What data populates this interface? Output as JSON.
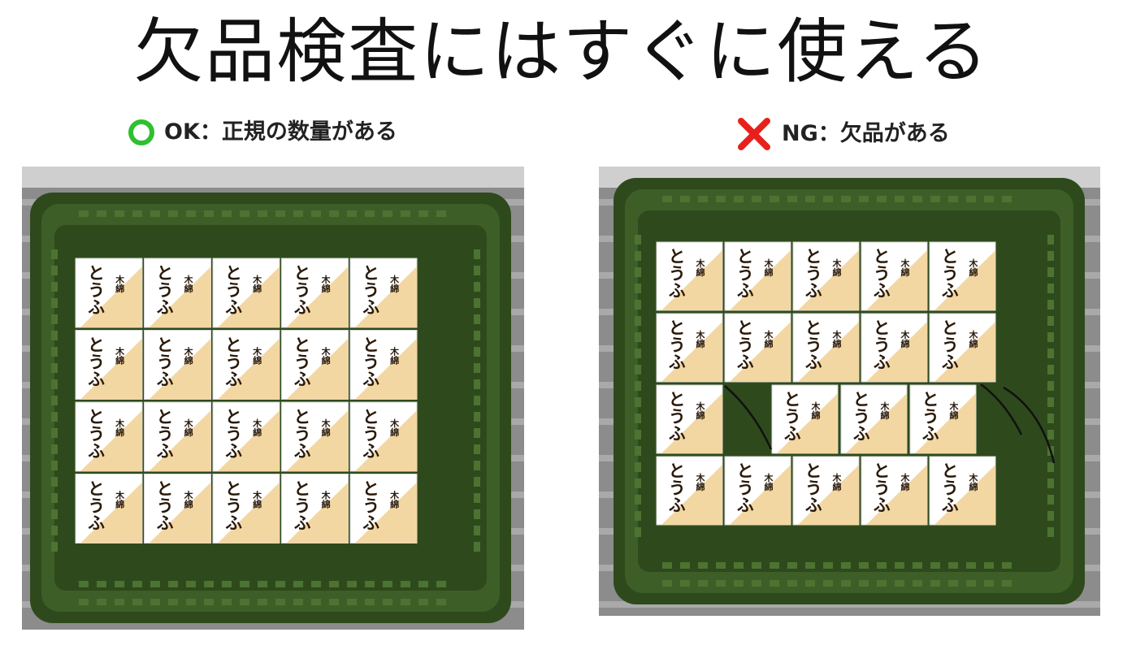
{
  "title": "欠品検査にはすぐに使える",
  "ok": {
    "caption": "OK：正規の数量がある",
    "icon": "green-circle-icon",
    "icon_color": "#2fbf2f",
    "tray_grid": {
      "rows": 4,
      "cols": 5
    }
  },
  "ng": {
    "caption": "NG：欠品がある",
    "icon": "red-cross-icon",
    "icon_color": "#e8201c",
    "tray_grid": {
      "rows": 4,
      "cols": 5,
      "missing": [
        [
          2,
          1
        ]
      ]
    }
  },
  "package": {
    "label_top": "木綿",
    "label_main": "とうふ",
    "label_color": "#f3d7a2"
  },
  "colors": {
    "tray_dark": "#2e4a1c",
    "tray_mid": "#3d5f27",
    "tray_light": "#4d7332"
  }
}
